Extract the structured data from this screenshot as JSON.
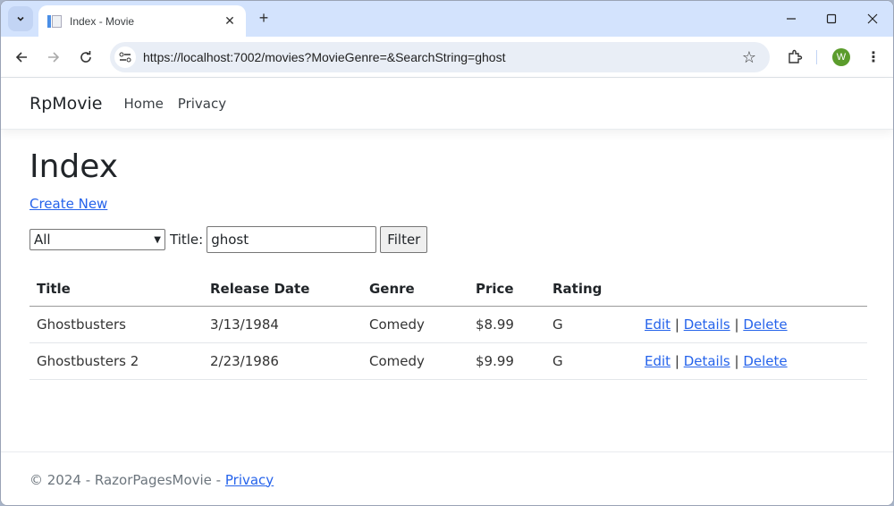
{
  "browser": {
    "tab_title": "Index - Movie",
    "url": "https://localhost:7002/movies?MovieGenre=&SearchString=ghost",
    "profile_initial": "W"
  },
  "site": {
    "brand": "RpMovie",
    "nav": [
      {
        "label": "Home"
      },
      {
        "label": "Privacy"
      }
    ]
  },
  "main": {
    "heading": "Index",
    "create_link": "Create New",
    "filter": {
      "genre_selected": "All",
      "title_label": "Title:",
      "search_value": "ghost",
      "button_label": "Filter"
    },
    "table": {
      "headers": [
        "Title",
        "Release Date",
        "Genre",
        "Price",
        "Rating",
        ""
      ],
      "rows": [
        {
          "title": "Ghostbusters",
          "release_date": "3/13/1984",
          "genre": "Comedy",
          "price": "$8.99",
          "rating": "G"
        },
        {
          "title": "Ghostbusters 2",
          "release_date": "2/23/1986",
          "genre": "Comedy",
          "price": "$9.99",
          "rating": "G"
        }
      ],
      "actions": {
        "edit": "Edit",
        "details": "Details",
        "delete": "Delete",
        "separator": "|"
      }
    }
  },
  "footer": {
    "text": "© 2024 - RazorPagesMovie - ",
    "link": "Privacy"
  }
}
